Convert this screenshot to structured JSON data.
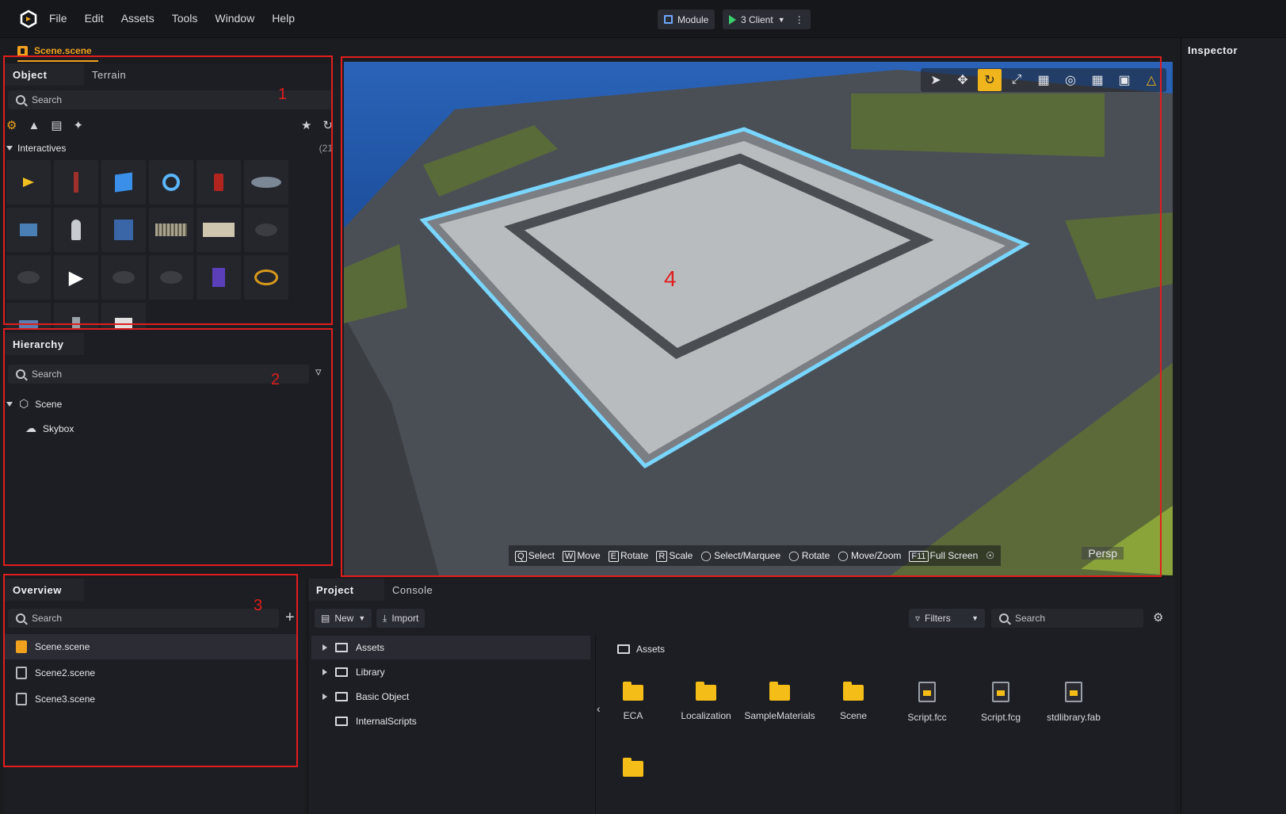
{
  "menu": {
    "items": [
      "File",
      "Edit",
      "Assets",
      "Tools",
      "Window",
      "Help"
    ]
  },
  "toolbar": {
    "module_label": "Module",
    "client_label": "3 Client"
  },
  "scene_tab": {
    "label": "Scene.scene"
  },
  "object_panel": {
    "tabs": [
      "Object",
      "Terrain"
    ],
    "search_placeholder": "Search",
    "section": {
      "label": "Interactives",
      "count": "(21"
    }
  },
  "hierarchy_panel": {
    "title": "Hierarchy",
    "search_placeholder": "Search",
    "nodes": [
      "Scene",
      "Skybox"
    ]
  },
  "overview_panel": {
    "title": "Overview",
    "search_placeholder": "Search",
    "files": [
      "Scene.scene",
      "Scene2.scene",
      "Scene3.scene"
    ]
  },
  "viewport": {
    "hints": [
      {
        "key": "Q",
        "label": "Select"
      },
      {
        "key": "W",
        "label": "Move"
      },
      {
        "key": "E",
        "label": "Rotate"
      },
      {
        "key": "R",
        "label": "Scale"
      },
      {
        "key": "",
        "label": "Select/Marquee"
      },
      {
        "key": "",
        "label": "Rotate"
      },
      {
        "key": "",
        "label": "Move/Zoom"
      },
      {
        "key": "F11",
        "label": "Full Screen"
      }
    ],
    "camera_label": "Persp"
  },
  "project_panel": {
    "tabs": [
      "Project",
      "Console"
    ],
    "new_label": "New",
    "import_label": "Import",
    "filters_label": "Filters",
    "search_placeholder": "Search",
    "tree": [
      "Assets",
      "Library",
      "Basic Object",
      "InternalScripts"
    ],
    "breadcrumb": "Assets",
    "assets": [
      {
        "name": "ECA",
        "kind": "folder"
      },
      {
        "name": "Localization",
        "kind": "folder"
      },
      {
        "name": "SampleMaterials",
        "kind": "folder"
      },
      {
        "name": "Scene",
        "kind": "folder"
      },
      {
        "name": "Script.fcc",
        "kind": "file"
      },
      {
        "name": "Script.fcg",
        "kind": "file"
      },
      {
        "name": "stdlibrary.fab",
        "kind": "file"
      }
    ]
  },
  "inspector": {
    "title": "Inspector"
  },
  "annotations": [
    "1",
    "2",
    "3",
    "4"
  ],
  "colors": {
    "accent": "#f0a21f",
    "annotation": "#e11d1d",
    "panel": "#1d1e23",
    "folder": "#f5bd17"
  }
}
